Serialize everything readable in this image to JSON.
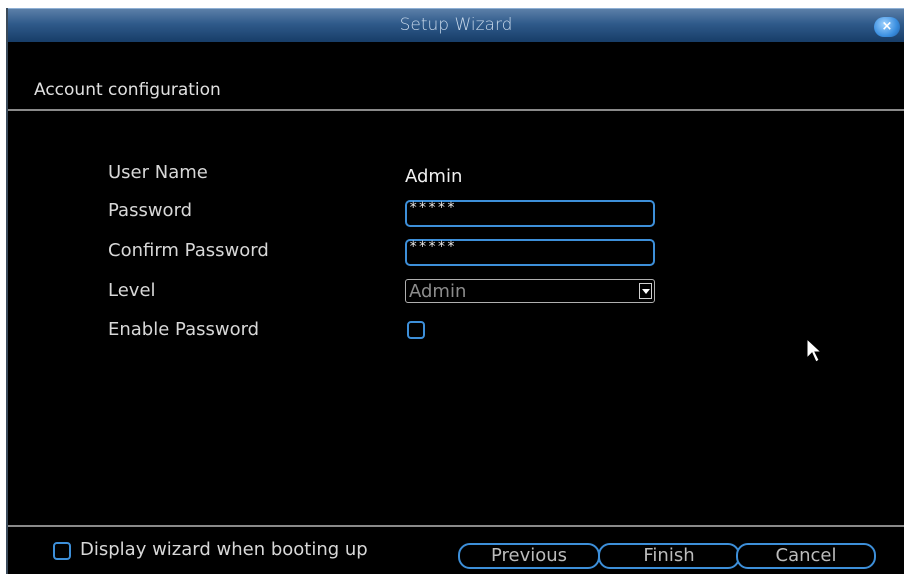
{
  "window": {
    "title": "Setup Wizard",
    "close_label": "×"
  },
  "section": {
    "title": "Account configuration"
  },
  "form": {
    "username_label": "User Name",
    "username_value": "Admin",
    "password_label": "Password",
    "password_value": "*****",
    "confirm_label": "Confirm Password",
    "confirm_value": "*****",
    "level_label": "Level",
    "level_value": "Admin",
    "enable_password_label": "Enable Password",
    "enable_password_checked": false
  },
  "footer": {
    "display_wizard_label": "Display wizard when booting up",
    "display_wizard_checked": false,
    "previous_label": "Previous",
    "finish_label": "Finish",
    "cancel_label": "Cancel"
  },
  "colors": {
    "accent": "#3d8fd9",
    "titlebar": "#2f5a8a",
    "background": "#000000"
  }
}
